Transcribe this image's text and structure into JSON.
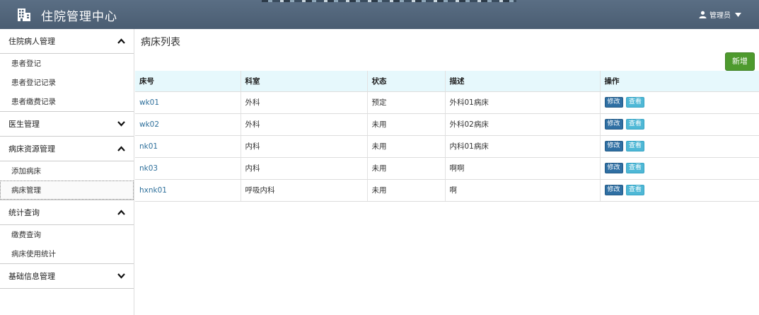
{
  "header": {
    "title": "住院管理中心",
    "user_label": "管理员",
    "brand_icon": "building-icon",
    "bg_color": "#4f6378"
  },
  "sidebar": {
    "groups": [
      {
        "label": "住院病人管理",
        "expanded": true,
        "items": [
          {
            "label": "患者登记"
          },
          {
            "label": "患者登记记录"
          },
          {
            "label": "患者缴费记录"
          }
        ]
      },
      {
        "label": "医生管理",
        "expanded": false,
        "items": []
      },
      {
        "label": "病床资源管理",
        "expanded": true,
        "items": [
          {
            "label": "添加病床"
          },
          {
            "label": "病床管理",
            "active": true
          }
        ]
      },
      {
        "label": "统计查询",
        "expanded": true,
        "items": [
          {
            "label": "缴费查询"
          },
          {
            "label": "病床使用统计"
          }
        ]
      },
      {
        "label": "基础信息管理",
        "expanded": false,
        "items": []
      }
    ]
  },
  "main": {
    "title": "病床列表",
    "add_button": "新增",
    "add_button_color": "#4e9a2e",
    "table": {
      "columns": [
        "床号",
        "科室",
        "状态",
        "描述",
        "操作"
      ],
      "rows": [
        {
          "bed_no": "wk01",
          "dept": "外科",
          "status": "预定",
          "desc": "外科01病床"
        },
        {
          "bed_no": "wk02",
          "dept": "外科",
          "status": "未用",
          "desc": "外科02病床"
        },
        {
          "bed_no": "nk01",
          "dept": "内科",
          "status": "未用",
          "desc": "内科01病床"
        },
        {
          "bed_no": "nk03",
          "dept": "内科",
          "status": "未用",
          "desc": "啊啊"
        },
        {
          "bed_no": "hxnk01",
          "dept": "呼吸内科",
          "status": "未用",
          "desc": "啊"
        }
      ],
      "edit_label": "修改",
      "view_label": "查看",
      "header_bg": "#e6f8fc"
    }
  }
}
